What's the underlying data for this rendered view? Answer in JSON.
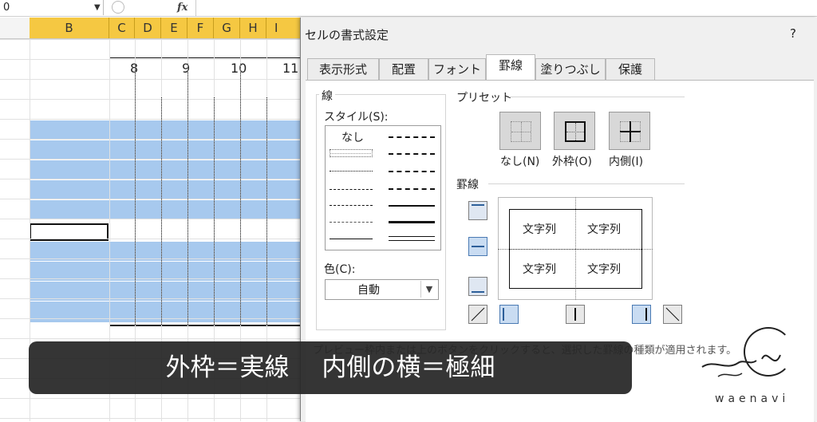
{
  "formula_bar": {
    "name_box": "0",
    "fx": "fx"
  },
  "spreadsheet": {
    "columns": [
      "B",
      "C",
      "D",
      "E",
      "F",
      "G",
      "H",
      "I"
    ],
    "time_labels": [
      "8",
      "9",
      "10",
      "11"
    ]
  },
  "dialog": {
    "title": "セルの書式設定",
    "help": "?",
    "tabs": [
      "表示形式",
      "配置",
      "フォント",
      "罫線",
      "塗りつぶし",
      "保護"
    ],
    "active_tab": "罫線",
    "line_group": {
      "legend": "線",
      "style_label": "スタイル(S):",
      "none_label": "なし",
      "color_label": "色(C):",
      "color_value": "自動"
    },
    "presets": {
      "label": "プリセット",
      "items": [
        "なし(N)",
        "外枠(O)",
        "内側(I)"
      ]
    },
    "border": {
      "label": "罫線",
      "preview_cells": [
        "文字列",
        "文字列",
        "文字列",
        "文字列"
      ]
    },
    "hint": "プレビュー枠内または上のボタンをクリックすると、選択した罫線の種類が適用されます。"
  },
  "caption": "外枠＝実線　 内側の横＝極細",
  "logo": {
    "text": "waenavi"
  },
  "colors": {
    "header_highlight": "#f5c842",
    "selection": "#a7c9ee",
    "caption_bg": "#262626"
  }
}
